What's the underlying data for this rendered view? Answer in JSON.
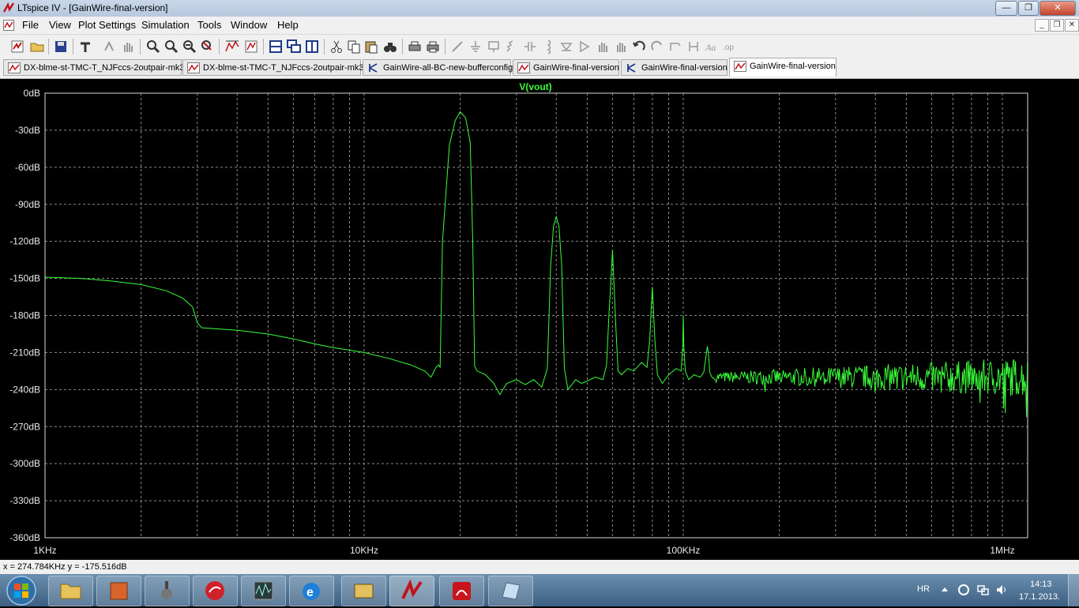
{
  "window": {
    "title": "LTspice IV - [GainWire-final-version]"
  },
  "menu": [
    "File",
    "View",
    "Plot Settings",
    "Simulation",
    "Tools",
    "Window",
    "Help"
  ],
  "tabs": [
    {
      "label": "DX-blme-st-TMC-T_NJFccs-2outpair-mk3",
      "kind": "wave",
      "active": false
    },
    {
      "label": "DX-blme-st-TMC-T_NJFccs-2outpair-mk3",
      "kind": "wave",
      "active": false
    },
    {
      "label": "GainWire-all-BC-new-bufferconfig",
      "kind": "schem",
      "active": false
    },
    {
      "label": "GainWire-final-version",
      "kind": "wave",
      "active": false
    },
    {
      "label": "GainWire-final-version",
      "kind": "schem",
      "active": false
    },
    {
      "label": "GainWire-final-version",
      "kind": "wave",
      "active": true
    }
  ],
  "chart_data": {
    "type": "line",
    "trace_label": "V(vout)",
    "x_scale": "log",
    "xlim": [
      1000,
      1200000
    ],
    "ylim": [
      -360,
      0
    ],
    "x_ticks": [
      {
        "value": 1000,
        "label": "1KHz"
      },
      {
        "value": 10000,
        "label": "10KHz"
      },
      {
        "value": 100000,
        "label": "100KHz"
      },
      {
        "value": 1000000,
        "label": "1MHz"
      }
    ],
    "y_ticks": [
      {
        "value": 0,
        "label": "0dB"
      },
      {
        "value": -30,
        "label": "-30dB"
      },
      {
        "value": -60,
        "label": "-60dB"
      },
      {
        "value": -90,
        "label": "-90dB"
      },
      {
        "value": -120,
        "label": "-120dB"
      },
      {
        "value": -150,
        "label": "-150dB"
      },
      {
        "value": -180,
        "label": "-180dB"
      },
      {
        "value": -210,
        "label": "-210dB"
      },
      {
        "value": -240,
        "label": "-240dB"
      },
      {
        "value": -270,
        "label": "-270dB"
      },
      {
        "value": -300,
        "label": "-300dB"
      },
      {
        "value": -330,
        "label": "-330dB"
      },
      {
        "value": -360,
        "label": "-360dB"
      }
    ],
    "grid": true,
    "colors": {
      "trace": "#39ff39",
      "grid": "#8a8a8a",
      "axis_text": "#e8e8e8"
    },
    "series": [
      {
        "x": [
          1000,
          1300,
          1600,
          2000,
          2400,
          2700,
          2900,
          3000,
          3100,
          4000,
          5000,
          6000,
          7000,
          8000,
          10000,
          12000,
          14000,
          15500,
          16200,
          16800,
          17100,
          17300,
          17600,
          18500,
          19300,
          20000,
          20800,
          21500,
          21900,
          22200,
          22600,
          24000,
          25500,
          26600,
          28000,
          30000,
          32000,
          34000,
          36000,
          37500,
          38400,
          39200,
          40000,
          40800,
          41600,
          42400,
          43500,
          46000,
          48000,
          50000,
          53000,
          56000,
          57500,
          58500,
          59500,
          60000,
          60500,
          61500,
          62500,
          64000,
          67000,
          70000,
          74000,
          77000,
          78500,
          79500,
          80000,
          80500,
          81500,
          83000,
          86000,
          90000,
          95000,
          98500,
          99600,
          100000,
          100400,
          101500,
          104000,
          108000,
          113000,
          116000,
          118000,
          119000,
          120000,
          121000,
          123000,
          126000
        ],
        "y": [
          -149,
          -150,
          -152,
          -155,
          -160,
          -166,
          -173,
          -186,
          -190,
          -192,
          -195,
          -199,
          -203,
          -206,
          -210,
          -215,
          -220,
          -225,
          -230,
          -222,
          -220,
          -222,
          -120,
          -42,
          -22,
          -15,
          -20,
          -40,
          -120,
          -221,
          -225,
          -228,
          -235,
          -244,
          -235,
          -232,
          -236,
          -232,
          -238,
          -223,
          -140,
          -108,
          -100,
          -108,
          -140,
          -223,
          -240,
          -232,
          -235,
          -233,
          -230,
          -232,
          -220,
          -180,
          -147,
          -127,
          -147,
          -190,
          -225,
          -228,
          -223,
          -225,
          -218,
          -222,
          -200,
          -170,
          -157,
          -170,
          -200,
          -228,
          -235,
          -228,
          -223,
          -225,
          -205,
          -180,
          -205,
          -225,
          -232,
          -228,
          -230,
          -226,
          -212,
          -205,
          -212,
          -226,
          -230,
          -232
        ]
      }
    ],
    "noise": {
      "x_start": 126000,
      "x_end": 1200000,
      "base": -230,
      "amp_start": 4,
      "amp_end": 16,
      "seed": 7
    }
  },
  "status": {
    "cursor_readout": "x = 274.784KHz   y = -175.516dB"
  },
  "taskbar": {
    "lang": "HR",
    "time": "14:13",
    "date": "17.1.2013."
  }
}
